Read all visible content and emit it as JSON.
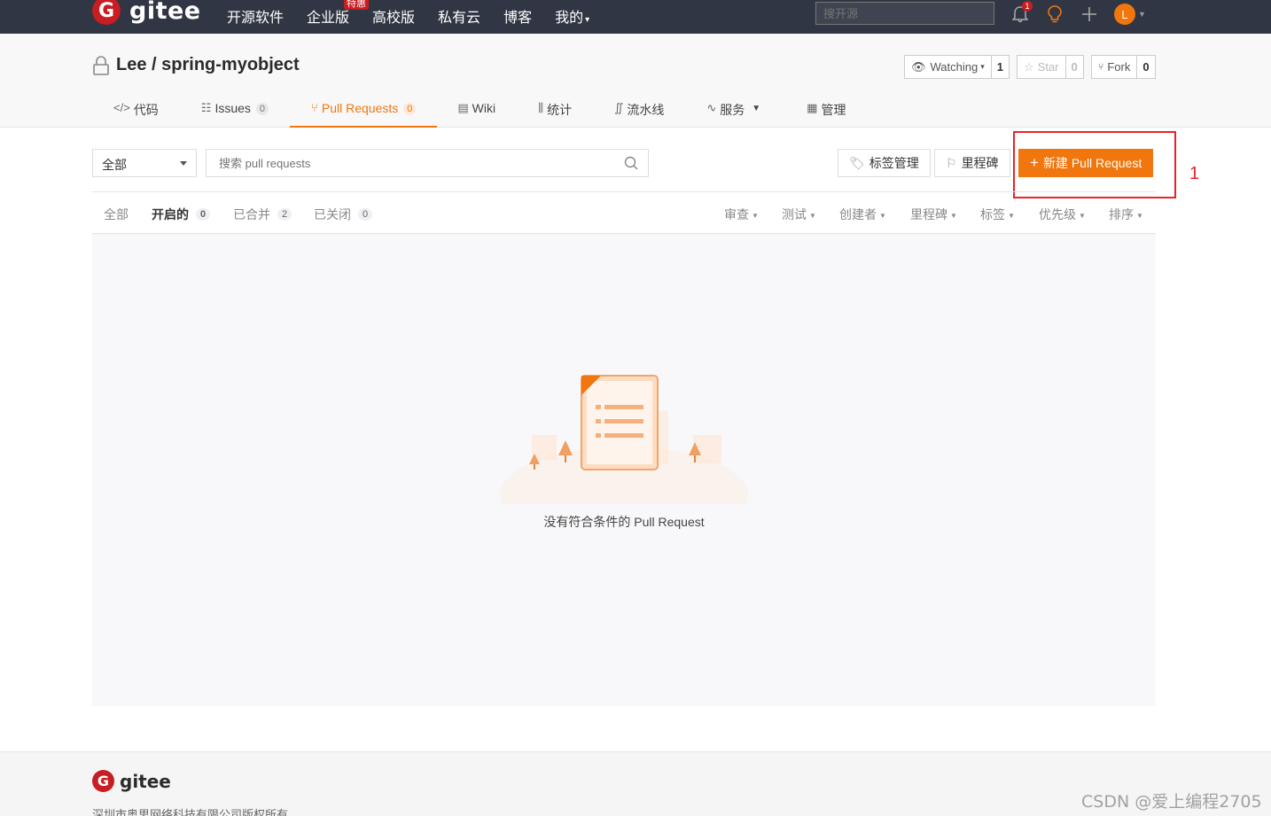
{
  "topnav": {
    "logo_mark": "G",
    "logo_text": "gitee",
    "links": [
      "开源软件",
      "企业版",
      "高校版",
      "私有云",
      "博客",
      "我的"
    ],
    "special_badge": "特惠",
    "search_placeholder": "搜开源",
    "notification_count": "1",
    "avatar_letter": "L"
  },
  "repo": {
    "title": "Lee / spring-myobject",
    "watching_label": "Watching",
    "watching_count": "1",
    "star_label": "Star",
    "star_count": "0",
    "fork_label": "Fork",
    "fork_count": "0"
  },
  "tabs": {
    "code": "代码",
    "issues": "Issues",
    "issues_count": "0",
    "pulls": "Pull Requests",
    "pulls_count": "0",
    "wiki": "Wiki",
    "stats": "统计",
    "pipeline": "流水线",
    "services": "服务",
    "manage": "管理"
  },
  "filterbar": {
    "scope_select": "全部",
    "search_placeholder": "搜索 pull requests",
    "labels_button": "标签管理",
    "milestone_button": "里程碑",
    "new_pr_button": "新建 Pull Request",
    "annotation": "1"
  },
  "states": {
    "all": "全部",
    "open": "开启的",
    "open_count": "0",
    "merged": "已合并",
    "merged_count": "2",
    "closed": "已关闭",
    "closed_count": "0"
  },
  "filters": {
    "review": "审查",
    "test": "测试",
    "author": "创建者",
    "milestone": "里程碑",
    "labels": "标签",
    "priority": "优先级",
    "sort": "排序"
  },
  "empty": {
    "message": "没有符合条件的 Pull Request"
  },
  "footer": {
    "logo_text": "gitee",
    "copyright": "深圳市奥思网络科技有限公司版权所有"
  },
  "watermark": "CSDN @爱上编程2705",
  "colors": {
    "accent": "#f0760d",
    "brand_red": "#c71d23",
    "nav_bg": "#303643",
    "annotation_red": "#e8232a"
  }
}
